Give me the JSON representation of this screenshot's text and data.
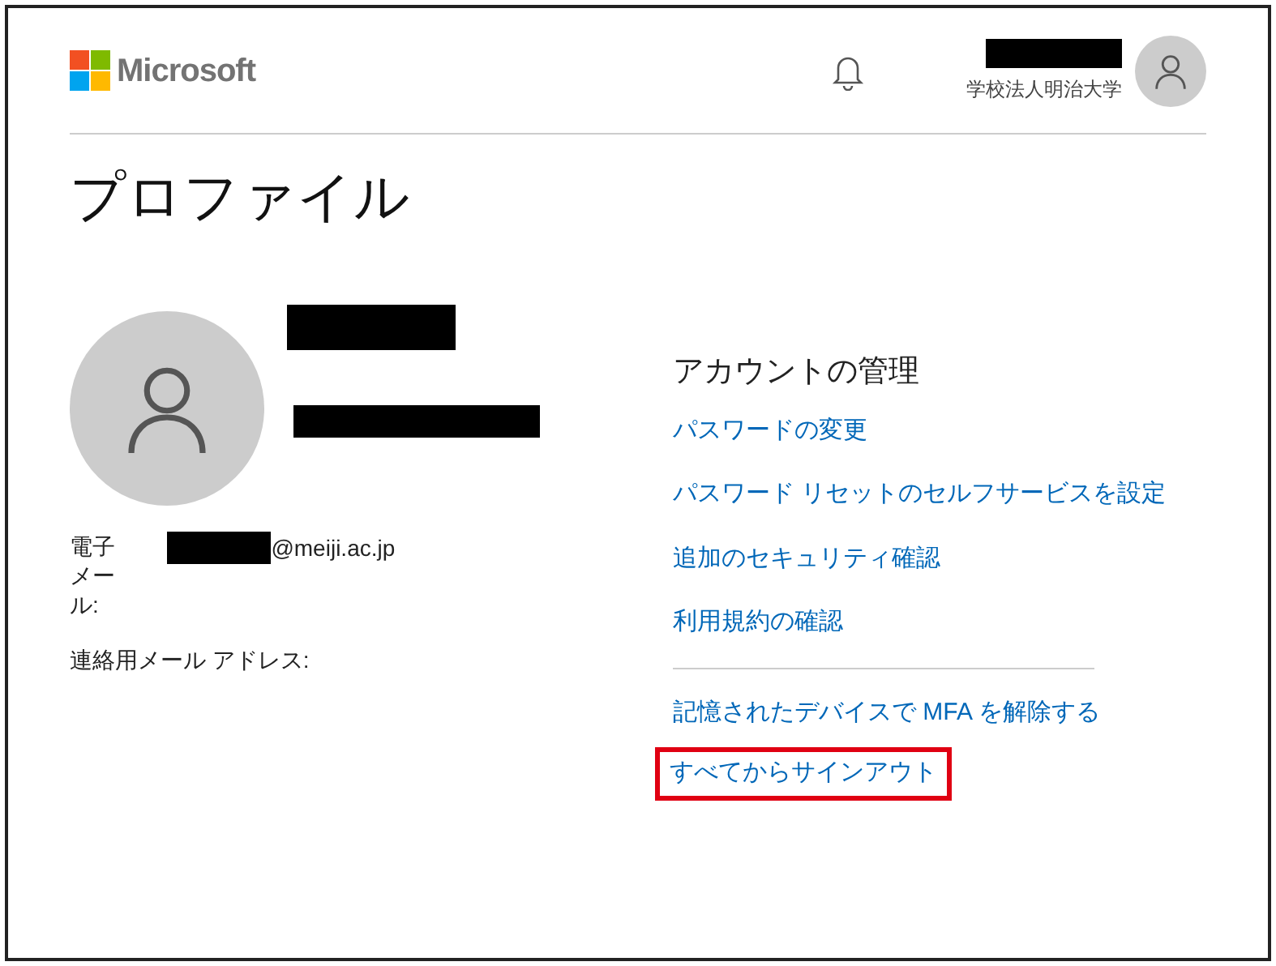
{
  "header": {
    "brand": "Microsoft",
    "organization": "学校法人明治大学"
  },
  "title": "プロファイル",
  "profile": {
    "email_label": "電子メール:",
    "email_domain": "@meiji.ac.jp",
    "contact_label": "連絡用メール アドレス:"
  },
  "account": {
    "heading": "アカウントの管理",
    "links": [
      {
        "label": "パスワードの変更",
        "highlighted": false
      },
      {
        "label": "パスワード リセットのセルフサービスを設定",
        "highlighted": false
      },
      {
        "label": "追加のセキュリティ確認",
        "highlighted": false
      },
      {
        "label": "利用規約の確認",
        "highlighted": false
      }
    ],
    "links_after_divider": [
      {
        "label": "記憶されたデバイスで MFA を解除する",
        "highlighted": false
      },
      {
        "label": "すべてからサインアウト",
        "highlighted": true
      }
    ]
  }
}
